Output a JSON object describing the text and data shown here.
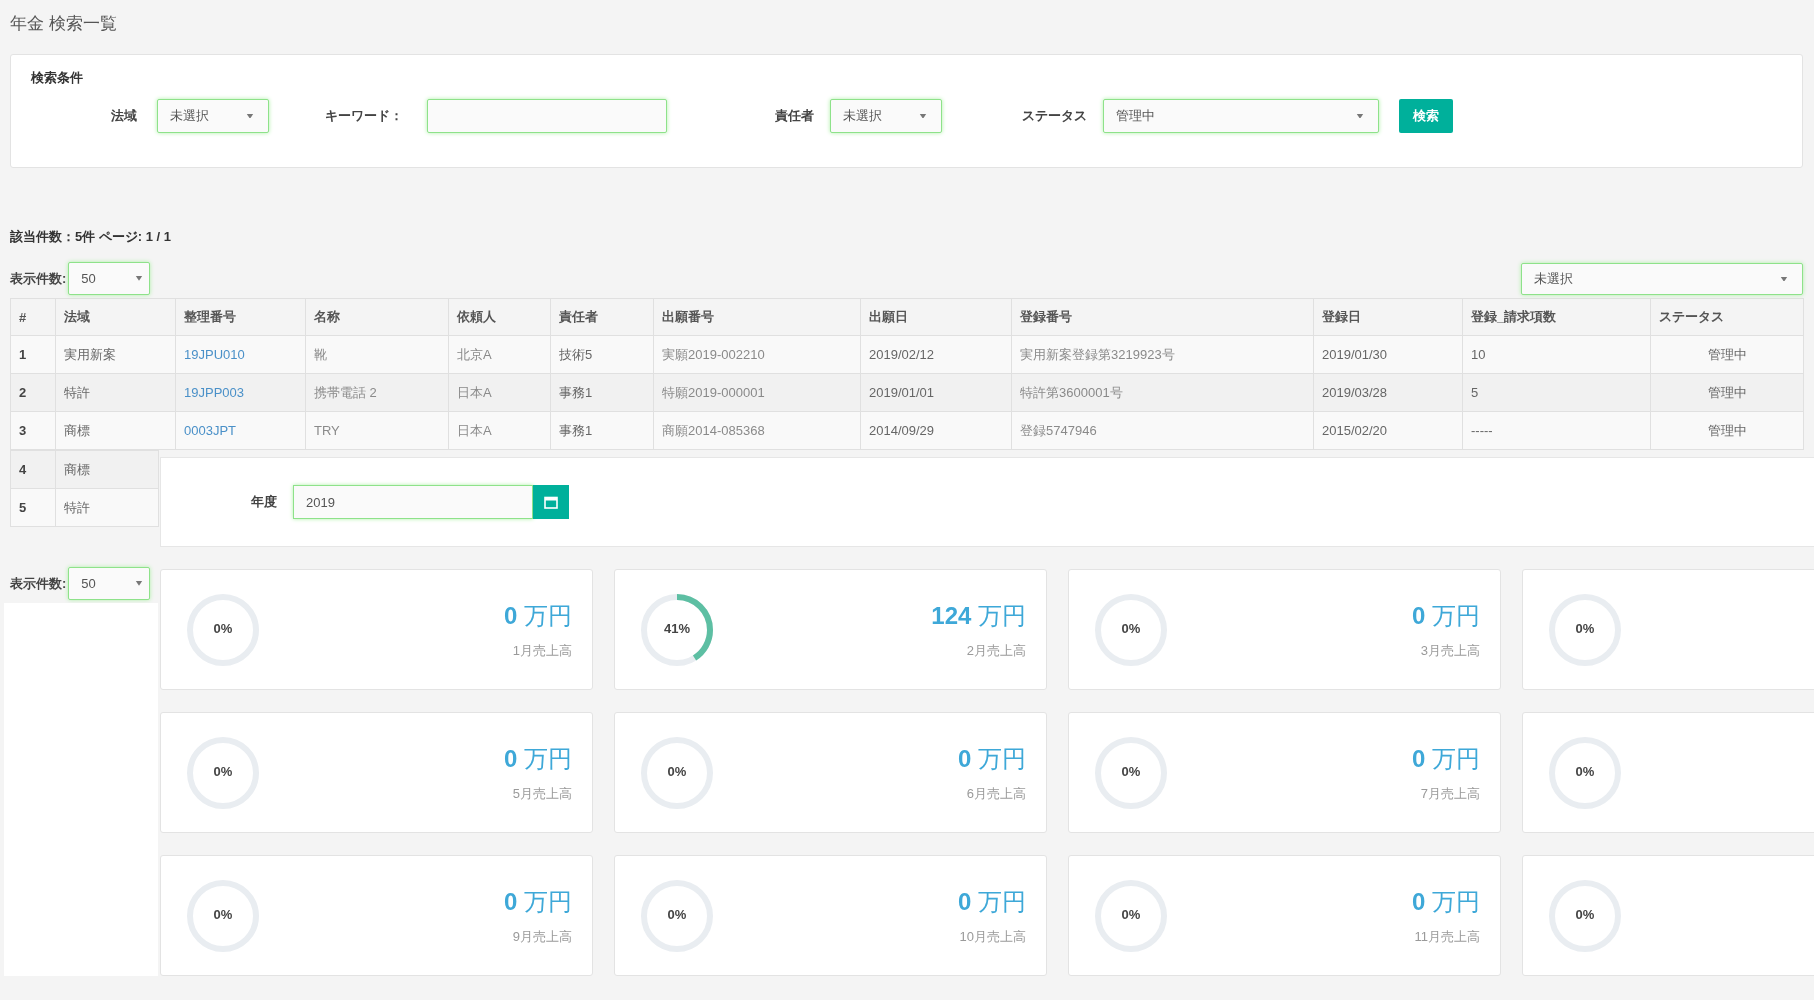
{
  "page_title": "年金 検索一覧",
  "search_panel": {
    "title": "検索条件",
    "fields": [
      {
        "kind": "select",
        "label": "法域",
        "value": "未選択"
      },
      {
        "kind": "text",
        "label": "キーワード："
      },
      {
        "kind": "select",
        "label": "責任者",
        "value": "未選択"
      },
      {
        "kind": "select",
        "label": "ステータス",
        "value": "管理中"
      }
    ],
    "button": "検索"
  },
  "result_summary": "該当件数：5件 ページ: 1 / 1",
  "page_size": {
    "label": "表示件数:",
    "value": "50"
  },
  "column_filter": {
    "value": "未選択"
  },
  "table": {
    "columns": [
      {
        "label": "#",
        "kind": "number"
      },
      {
        "label": "法域",
        "kind": "text"
      },
      {
        "label": "整理番号",
        "kind": "link"
      },
      {
        "label": "名称",
        "kind": "muted"
      },
      {
        "label": "依頼人",
        "kind": "muted"
      },
      {
        "label": "責任者",
        "kind": "text"
      },
      {
        "label": "出願番号",
        "kind": "muted"
      },
      {
        "label": "出願日",
        "kind": "text"
      },
      {
        "label": "登録番号",
        "kind": "muted"
      },
      {
        "label": "登録日",
        "kind": "text"
      },
      {
        "label": "登録_請求項数",
        "kind": "text"
      },
      {
        "label": "ステータス",
        "kind": "status"
      }
    ],
    "rows": [
      {
        "cells": [
          "1",
          "実用新案",
          "19JPU010",
          "靴",
          "北京A",
          "技術5",
          "実願2019-002210",
          "2019/02/12",
          "実用新案登録第3219923号",
          "2019/01/30",
          "10",
          "管理中"
        ]
      },
      {
        "cells": [
          "2",
          "特許",
          "19JPP003",
          "携帯電話 2",
          "日本A",
          "事務1",
          "特願2019-000001",
          "2019/01/01",
          "特許第3600001号",
          "2019/03/28",
          "5",
          "管理中"
        ]
      },
      {
        "cells": [
          "3",
          "商標",
          "0003JPT",
          "TRY",
          "日本A",
          "事務1",
          "商願2014-085368",
          "2014/09/29",
          "登録5747946",
          "2015/02/20",
          "-----",
          "管理中"
        ]
      },
      {
        "cells": [
          "4",
          "商標"
        ]
      },
      {
        "cells": [
          "5",
          "特許"
        ]
      }
    ]
  },
  "year_filter": {
    "label": "年度",
    "value": "2019"
  },
  "page_size_2": {
    "label": "表示件数:",
    "value": "50"
  },
  "sales_cards": [
    {
      "percent": "0%",
      "level": 0,
      "amount": "**0** 万円",
      "label": "1月売上高"
    },
    {
      "percent": "41%",
      "level": 0.41,
      "amount": "**124** 万円",
      "label": "2月売上高"
    },
    {
      "percent": "0%",
      "level": 0,
      "amount": "**0** 万円",
      "label": "3月売上高"
    },
    {
      "percent": "0%",
      "level": 0
    },
    {
      "percent": "0%",
      "level": 0,
      "amount": "**0** 万円",
      "label": "5月売上高"
    },
    {
      "percent": "0%",
      "level": 0,
      "amount": "**0** 万円",
      "label": "6月売上高"
    },
    {
      "percent": "0%",
      "level": 0,
      "amount": "**0** 万円",
      "label": "7月売上高"
    },
    {
      "percent": "0%",
      "level": 0
    },
    {
      "percent": "0%",
      "level": 0,
      "amount": "**0** 万円",
      "label": "9月売上高"
    },
    {
      "percent": "0%",
      "level": 0,
      "amount": "**0** 万円",
      "label": "10月売上高"
    },
    {
      "percent": "0%",
      "level": 0,
      "amount": "**0** 万円",
      "label": "11月売上高"
    },
    {
      "percent": "0%",
      "level": 0
    }
  ]
}
